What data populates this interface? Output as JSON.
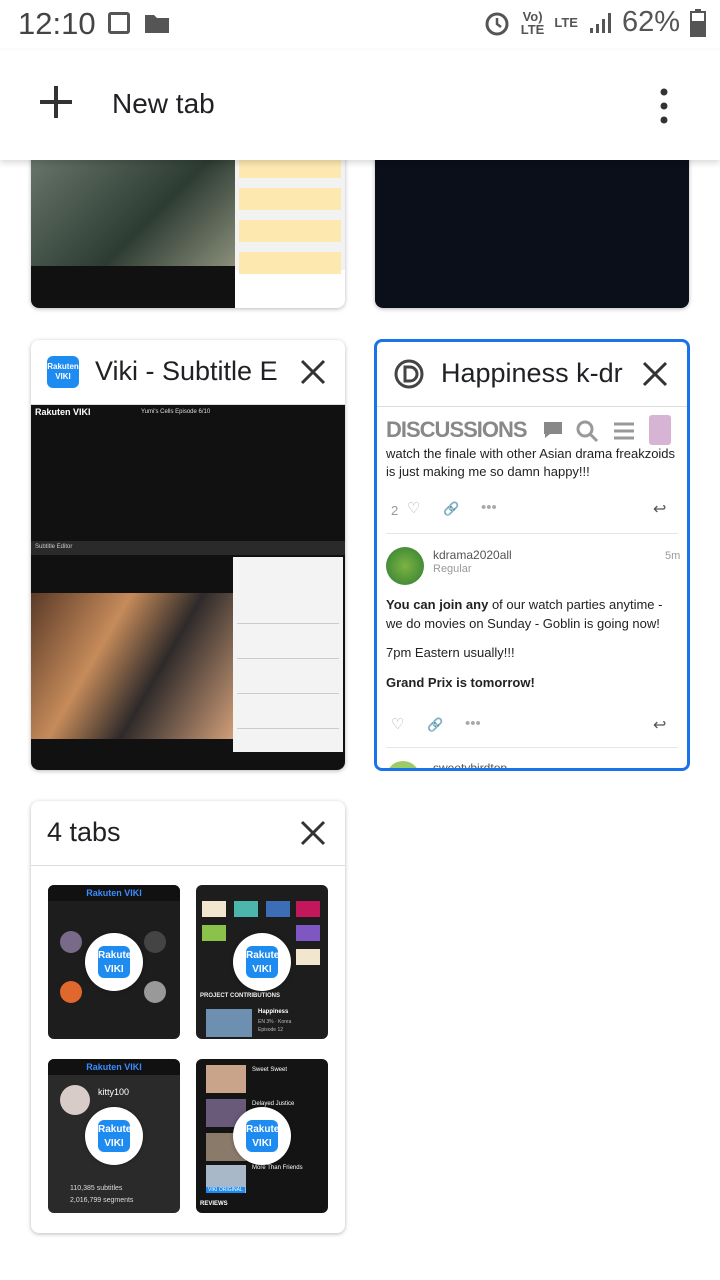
{
  "status_bar": {
    "time": "12:10",
    "battery": "62%",
    "network": "LTE"
  },
  "toolbar": {
    "new_tab_label": "New tab"
  },
  "tabs": [
    {
      "title": "Viki - Subtitle E",
      "favicon": "viki-logo",
      "favicon_text": "Rakuten VIKI"
    },
    {
      "title": "Happiness k-dr",
      "favicon": "disqus-logo"
    }
  ],
  "discussion": {
    "header": "DISCUSSIONS",
    "comment1_text": "watch the finale with other Asian drama freakzoids is just making me so damn happy!!!",
    "comment1_likes": "2",
    "comment2_user": "kdrama2020all",
    "comment2_role": "Regular",
    "comment2_time": "5m",
    "comment2_line1_bold": "You can join any",
    "comment2_line1_rest": " of our watch parties anytime - we do movies on Sunday - Goblin is going now!",
    "comment2_line2": "7pm Eastern usually!!!",
    "comment2_line3": "Grand Prix is tomorrow!",
    "next_user": "sweetybirdtop"
  },
  "viki_player": {
    "brand": "Rakuten VIKI",
    "episode": "Yumi's Cells Episode 6/10",
    "subtitle_tab": "Subtitle Editor"
  },
  "group": {
    "label": "4 tabs",
    "badge_text": "Rakuten VIKI",
    "mini1": {
      "brand": "Rakuten VIKI"
    },
    "mini2": {
      "caption": "PROJECT CONTRIBUTIONS",
      "show": "Happiness",
      "meta": "EN 3% · Korea",
      "episode": "Episode 12"
    },
    "mini3": {
      "brand": "Rakuten VIKI",
      "user": "kitty100",
      "subtitles": "110,385 subtitles",
      "segments": "2,016,799 segments"
    },
    "mini4": {
      "items": [
        "Sweet Sweet",
        "Delayed Justice",
        "More Than Friends"
      ],
      "footer": "REVIEWS",
      "original": "VIKI ORIGINAL"
    }
  }
}
